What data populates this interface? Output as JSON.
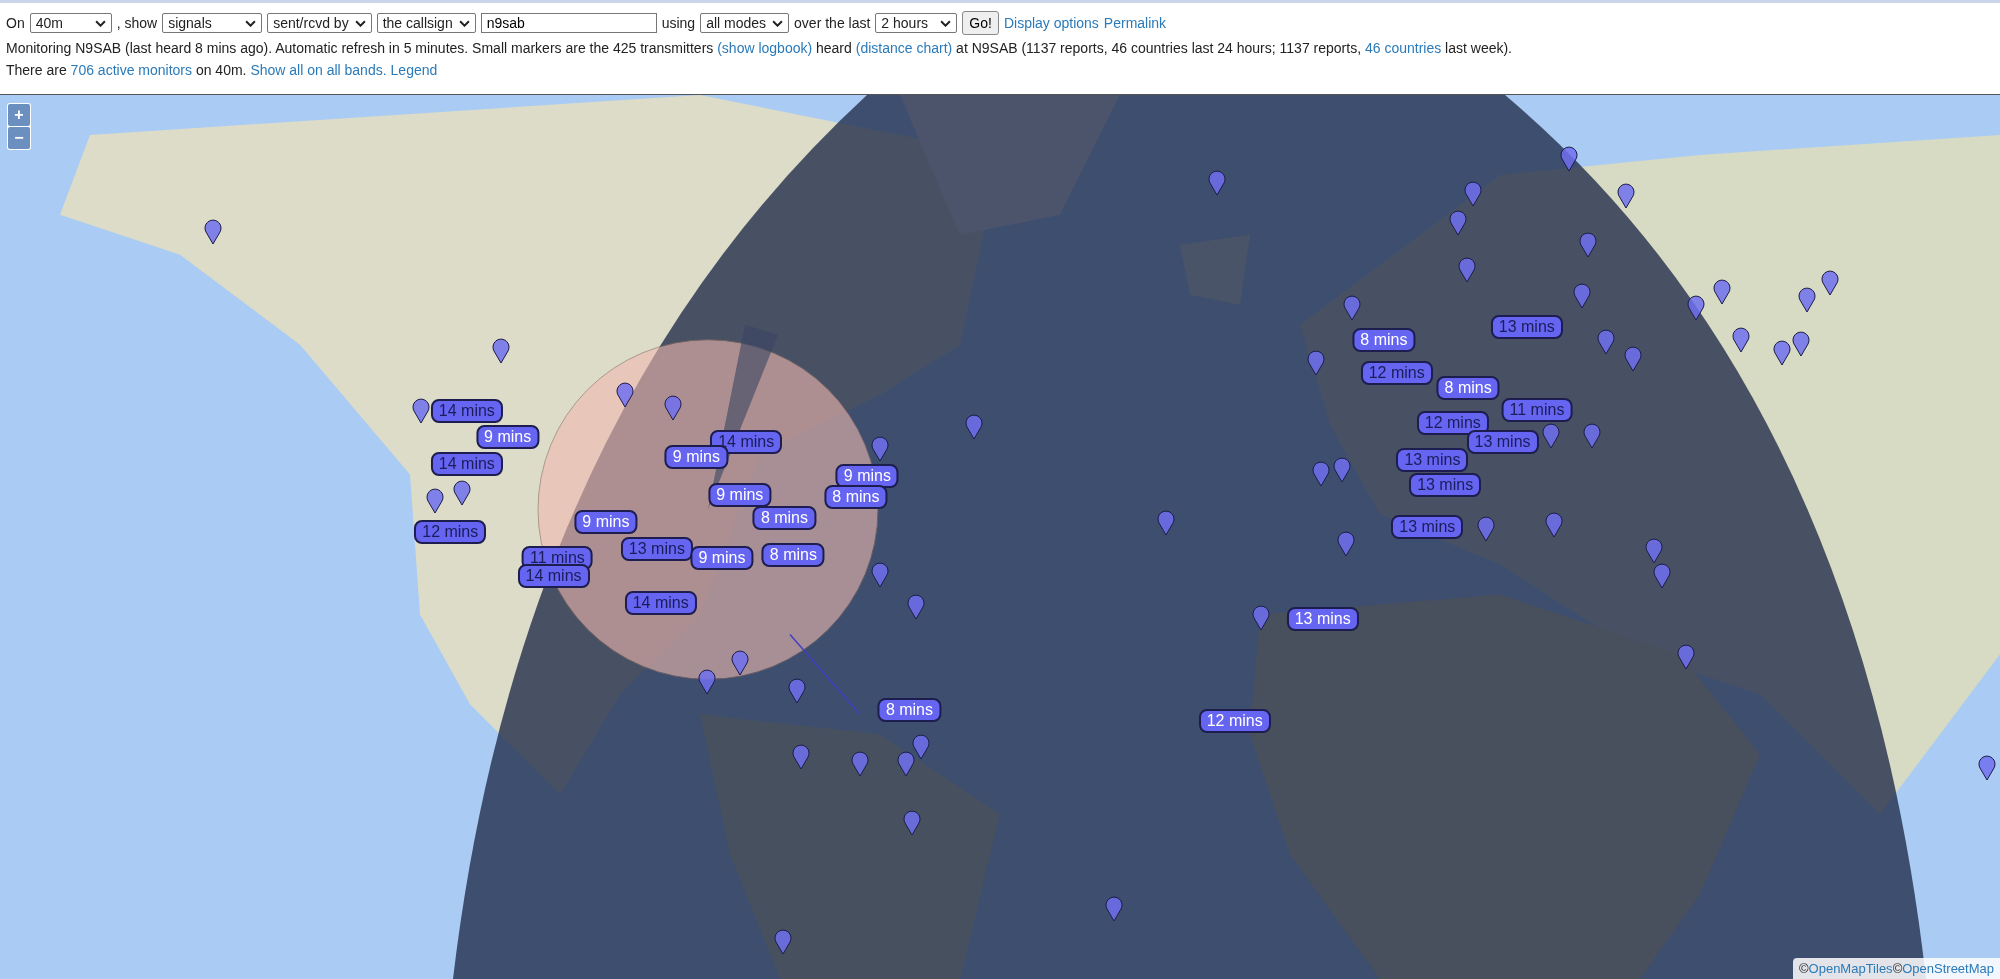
{
  "toolbar": [
    {
      "kind": "text",
      "text": "On"
    },
    {
      "kind": "select",
      "value": "40m"
    },
    {
      "kind": "text",
      "text": ", show"
    },
    {
      "kind": "select",
      "value": "signals"
    },
    {
      "kind": "select",
      "value": "sent/rcvd by"
    },
    {
      "kind": "select",
      "value": "the callsign"
    },
    {
      "kind": "input",
      "value": "n9sab"
    },
    {
      "kind": "text",
      "text": "using"
    },
    {
      "kind": "select",
      "value": "all modes"
    },
    {
      "kind": "text",
      "text": "over the last"
    },
    {
      "kind": "select",
      "value": "2 hours"
    },
    {
      "kind": "button",
      "text": "Go!"
    },
    {
      "kind": "link",
      "text": "Display options"
    },
    {
      "kind": "link",
      "text": "Permalink"
    }
  ],
  "status_lines": [
    [
      {
        "kind": "text",
        "text": "Monitoring N9SAB (last heard 8 mins ago). Automatic refresh in 5 minutes. Small markers are the 425 transmitters "
      },
      {
        "kind": "link",
        "text": "(show logbook)"
      },
      {
        "kind": "text",
        "text": " heard "
      },
      {
        "kind": "link",
        "text": "(distance chart)"
      },
      {
        "kind": "text",
        "text": " at N9SAB (1137 reports, 46 countries last 24 hours; 1137 reports, "
      },
      {
        "kind": "link",
        "text": "46 countries"
      },
      {
        "kind": "text",
        "text": " last week)."
      }
    ],
    [
      {
        "kind": "text",
        "text": "There are "
      },
      {
        "kind": "link",
        "text": "706 active monitors"
      },
      {
        "kind": "text",
        "text": " on 40m. "
      },
      {
        "kind": "link",
        "text": "Show all on all bands."
      },
      {
        "kind": "link",
        "text": "Legend"
      }
    ]
  ],
  "map": {
    "zoom_buttons": [
      "+",
      "−"
    ],
    "labels": [
      {
        "text": "8 mins",
        "kind": "bright"
      },
      {
        "text": "13 mins",
        "kind": "plain"
      },
      {
        "text": "12 mins",
        "kind": "plain"
      },
      {
        "text": "8 mins",
        "kind": "bright"
      },
      {
        "text": "11 mins",
        "kind": "plain"
      },
      {
        "text": "12 mins",
        "kind": "plain"
      },
      {
        "text": "13 mins",
        "kind": "plain"
      },
      {
        "text": "13 mins",
        "kind": "plain"
      },
      {
        "text": "13 mins",
        "kind": "plain"
      },
      {
        "text": "13 mins",
        "kind": "plain"
      },
      {
        "text": "13 mins",
        "kind": "bright"
      },
      {
        "text": "12 mins",
        "kind": "bright"
      },
      {
        "text": "8 mins",
        "kind": "bright"
      },
      {
        "text": "14 mins",
        "kind": "plain"
      },
      {
        "text": "9 mins",
        "kind": "bright"
      },
      {
        "text": "14 mins",
        "kind": "plain"
      },
      {
        "text": "12 mins",
        "kind": "plain"
      },
      {
        "text": "11 mins",
        "kind": "plain"
      },
      {
        "text": "14 mins",
        "kind": "plain"
      },
      {
        "text": "9 mins",
        "kind": "bright"
      },
      {
        "text": "14 mins",
        "kind": "plain"
      },
      {
        "text": "9 mins",
        "kind": "bright"
      },
      {
        "text": "9 mins",
        "kind": "bright"
      },
      {
        "text": "9 mins",
        "kind": "bright"
      },
      {
        "text": "8 mins",
        "kind": "bright"
      },
      {
        "text": "8 mins",
        "kind": "bright"
      },
      {
        "text": "13 mins",
        "kind": "plain"
      },
      {
        "text": "9 mins",
        "kind": "bright"
      },
      {
        "text": "8 mins",
        "kind": "bright"
      },
      {
        "text": "14 mins",
        "kind": "plain"
      }
    ],
    "attribution": [
      {
        "kind": "text",
        "text": "©"
      },
      {
        "kind": "link",
        "text": "OpenMapTiles"
      },
      {
        "kind": "text",
        "text": "©"
      },
      {
        "kind": "link",
        "text": "OpenStreetMap"
      }
    ]
  }
}
